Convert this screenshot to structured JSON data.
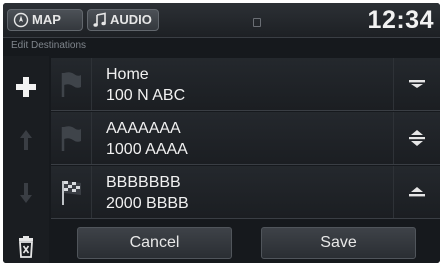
{
  "topbar": {
    "map_label": "MAP",
    "audio_label": "AUDIO",
    "clock": "12:34"
  },
  "page": {
    "subtitle": "Edit Destinations"
  },
  "destinations": [
    {
      "name": "Home",
      "address": "100 N ABC",
      "icon": "flag-icon",
      "move": "move-down-icon"
    },
    {
      "name": "AAAAAAA",
      "address": "1000 AAAA",
      "icon": "flag-icon",
      "move": "move-up-down-icon"
    },
    {
      "name": "BBBBBBB",
      "address": "2000 BBBB",
      "icon": "checkered-flag-icon",
      "move": "move-up-icon"
    }
  ],
  "left_tools": [
    "add-icon",
    "move-up-icon",
    "move-down-icon",
    "delete-icon"
  ],
  "buttons": {
    "cancel": "Cancel",
    "save": "Save"
  },
  "colors": {
    "background": "#16191d",
    "text": "#f1f1f1",
    "subtitle": "#7f858c"
  }
}
